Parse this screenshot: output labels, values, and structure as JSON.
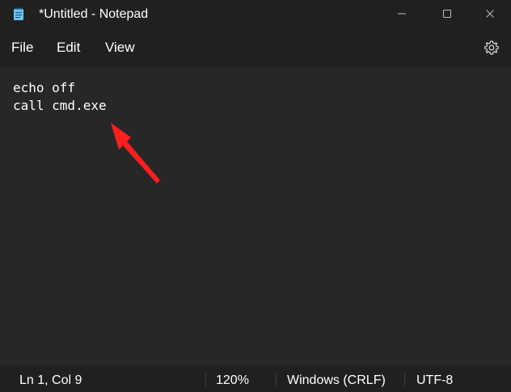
{
  "window": {
    "title": "*Untitled - Notepad",
    "app_icon": "notepad-icon",
    "controls": {
      "minimize_icon": "minimize-icon",
      "maximize_icon": "maximize-icon",
      "close_icon": "close-icon"
    }
  },
  "menu": {
    "items": [
      {
        "label": "File"
      },
      {
        "label": "Edit"
      },
      {
        "label": "View"
      }
    ],
    "settings_icon": "gear-icon"
  },
  "editor": {
    "lines": [
      "echo off",
      "call cmd.exe"
    ],
    "annotation": "red-arrow-pointing-to-line-2"
  },
  "status": {
    "position": "Ln 1, Col 9",
    "zoom": "120%",
    "line_ending": "Windows (CRLF)",
    "encoding": "UTF-8"
  },
  "colors": {
    "background": "#272727",
    "chrome": "#202020",
    "text": "#ffffff",
    "annotation": "#ff1e1e",
    "icon_accent": "#6ec6f5"
  }
}
